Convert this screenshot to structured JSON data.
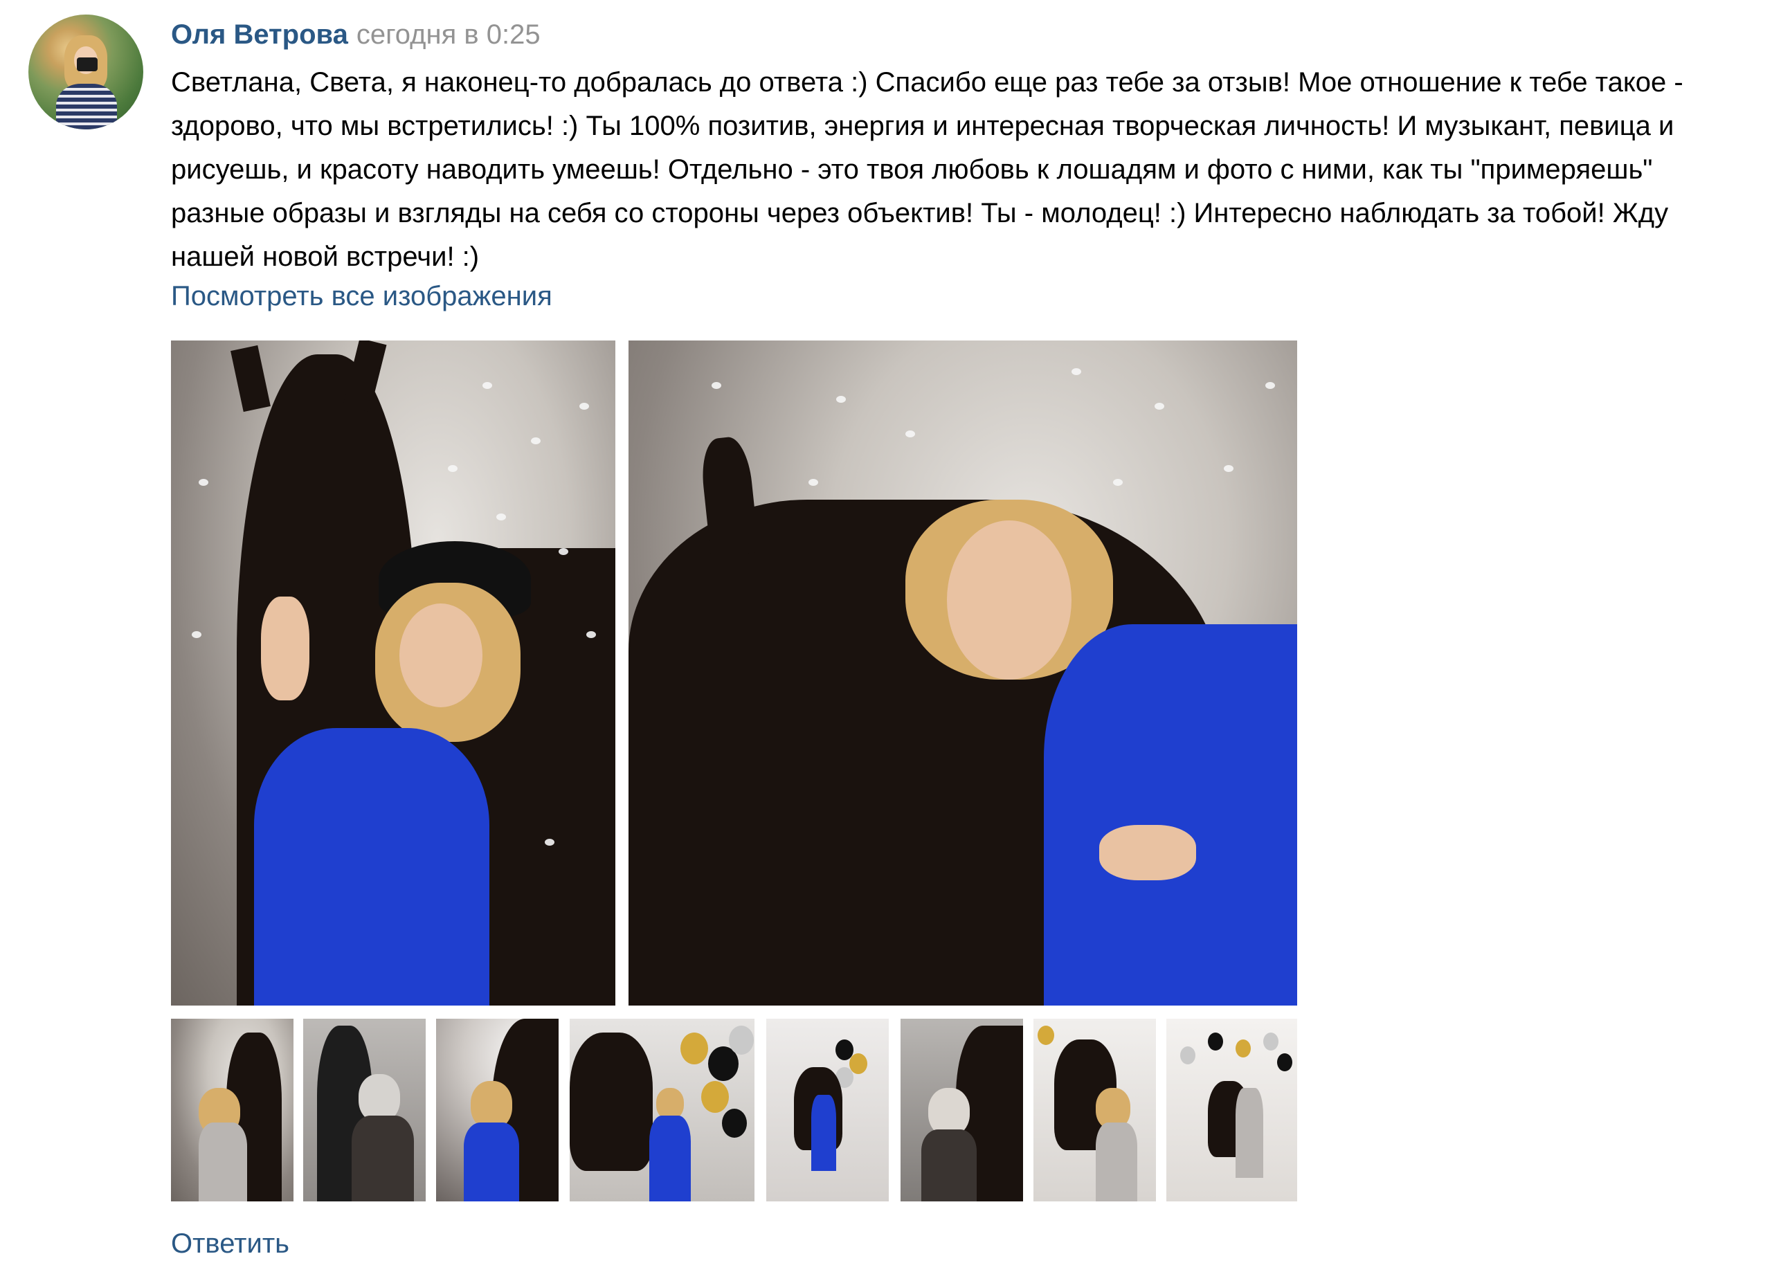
{
  "author": {
    "name": "Оля Ветрова",
    "date": "сегодня в 0:25",
    "avatar_icon": "avatar-photo"
  },
  "post": {
    "text": "Светлана, Света, я наконец-то добралась до ответа :) Спасибо еще раз тебе за отзыв! Мое отношение к тебе такое - здорово, что мы встретились! :) Ты 100% позитив, энергия и интересная творческая личность! И музыкант, певица и рисуешь, и красоту наводить умеешь! Отдельно - это твоя любовь к лошадям и фото с ними, как ты \"примеряешь\" разные образы и взгляды на себя со стороны через объектив! Ты - молодец! :) Интересно наблюдать за тобой! Жду нашей новой встречи! :)",
    "show_all_images": "Посмотреть все изображения",
    "reply": "Ответить"
  },
  "photos": {
    "large_count": 2,
    "thumbnail_count": 8
  },
  "colors": {
    "link": "#2a5885",
    "date": "#939393",
    "text": "#000000",
    "background": "#ffffff"
  }
}
